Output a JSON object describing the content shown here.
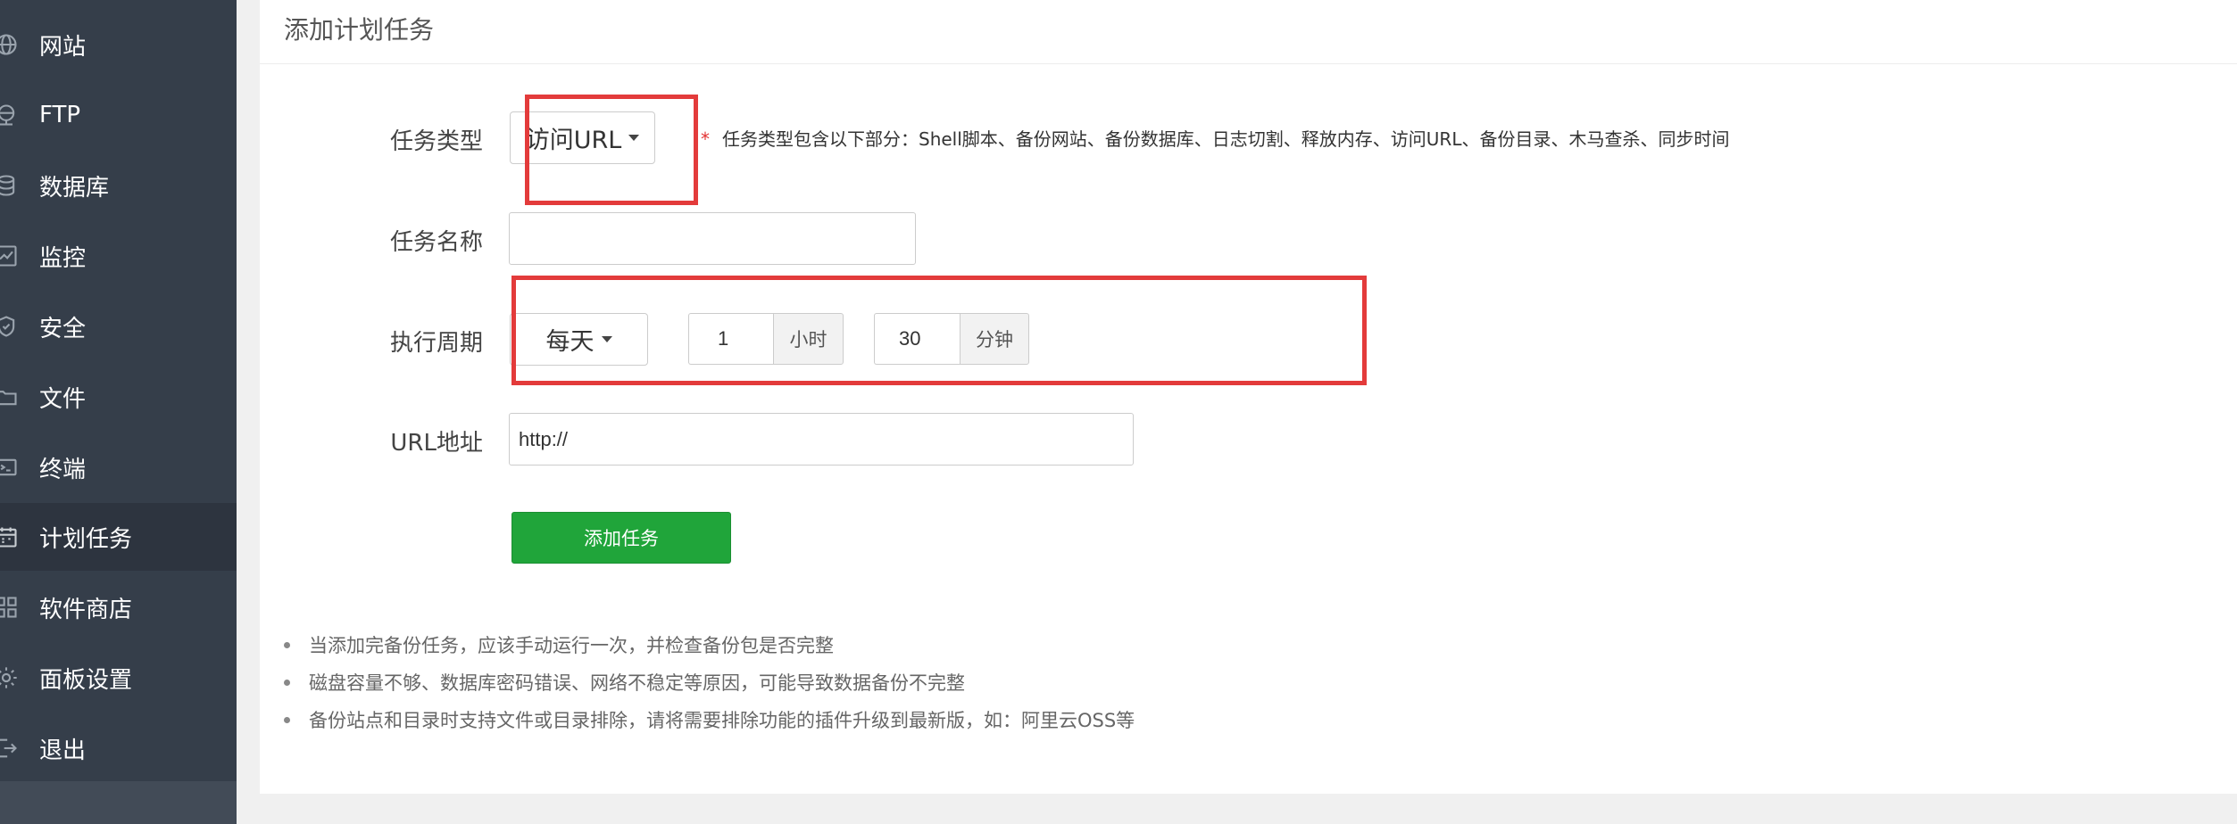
{
  "sidebar": {
    "items": [
      {
        "label": "网站",
        "icon": "globe-icon"
      },
      {
        "label": "FTP",
        "icon": "ftp-server-icon"
      },
      {
        "label": "数据库",
        "icon": "database-icon"
      },
      {
        "label": "监控",
        "icon": "monitor-icon"
      },
      {
        "label": "安全",
        "icon": "shield-icon"
      },
      {
        "label": "文件",
        "icon": "folder-icon"
      },
      {
        "label": "终端",
        "icon": "terminal-icon"
      },
      {
        "label": "计划任务",
        "icon": "calendar-icon",
        "active": true
      },
      {
        "label": "软件商店",
        "icon": "grid-icon"
      },
      {
        "label": "面板设置",
        "icon": "gear-icon"
      },
      {
        "label": "退出",
        "icon": "logout-icon"
      }
    ]
  },
  "panel": {
    "title": "添加计划任务"
  },
  "form": {
    "task_type": {
      "label": "任务类型",
      "value": "访问URL",
      "hint_star": "*",
      "hint": "任务类型包含以下部分：Shell脚本、备份网站、备份数据库、日志切割、释放内存、访问URL、备份目录、木马查杀、同步时间"
    },
    "task_name": {
      "label": "任务名称",
      "value": ""
    },
    "cycle": {
      "label": "执行周期",
      "value": "每天",
      "hour_value": "1",
      "hour_unit": "小时",
      "minute_value": "30",
      "minute_unit": "分钟"
    },
    "url": {
      "label": "URL地址",
      "value": "http://"
    },
    "submit_label": "添加任务"
  },
  "tips": [
    "当添加完备份任务，应该手动运行一次，并检查备份包是否完整",
    "磁盘容量不够、数据库密码错误、网络不稳定等原因，可能导致数据备份不完整",
    "备份站点和目录时支持文件或目录排除，请将需要排除功能的插件升级到最新版，如：阿里云OSS等"
  ],
  "colors": {
    "sidebar_bg": "#353e4a",
    "sidebar_active": "#2d343f",
    "primary_button": "#20a53a",
    "highlight_box": "#e33b3b"
  }
}
